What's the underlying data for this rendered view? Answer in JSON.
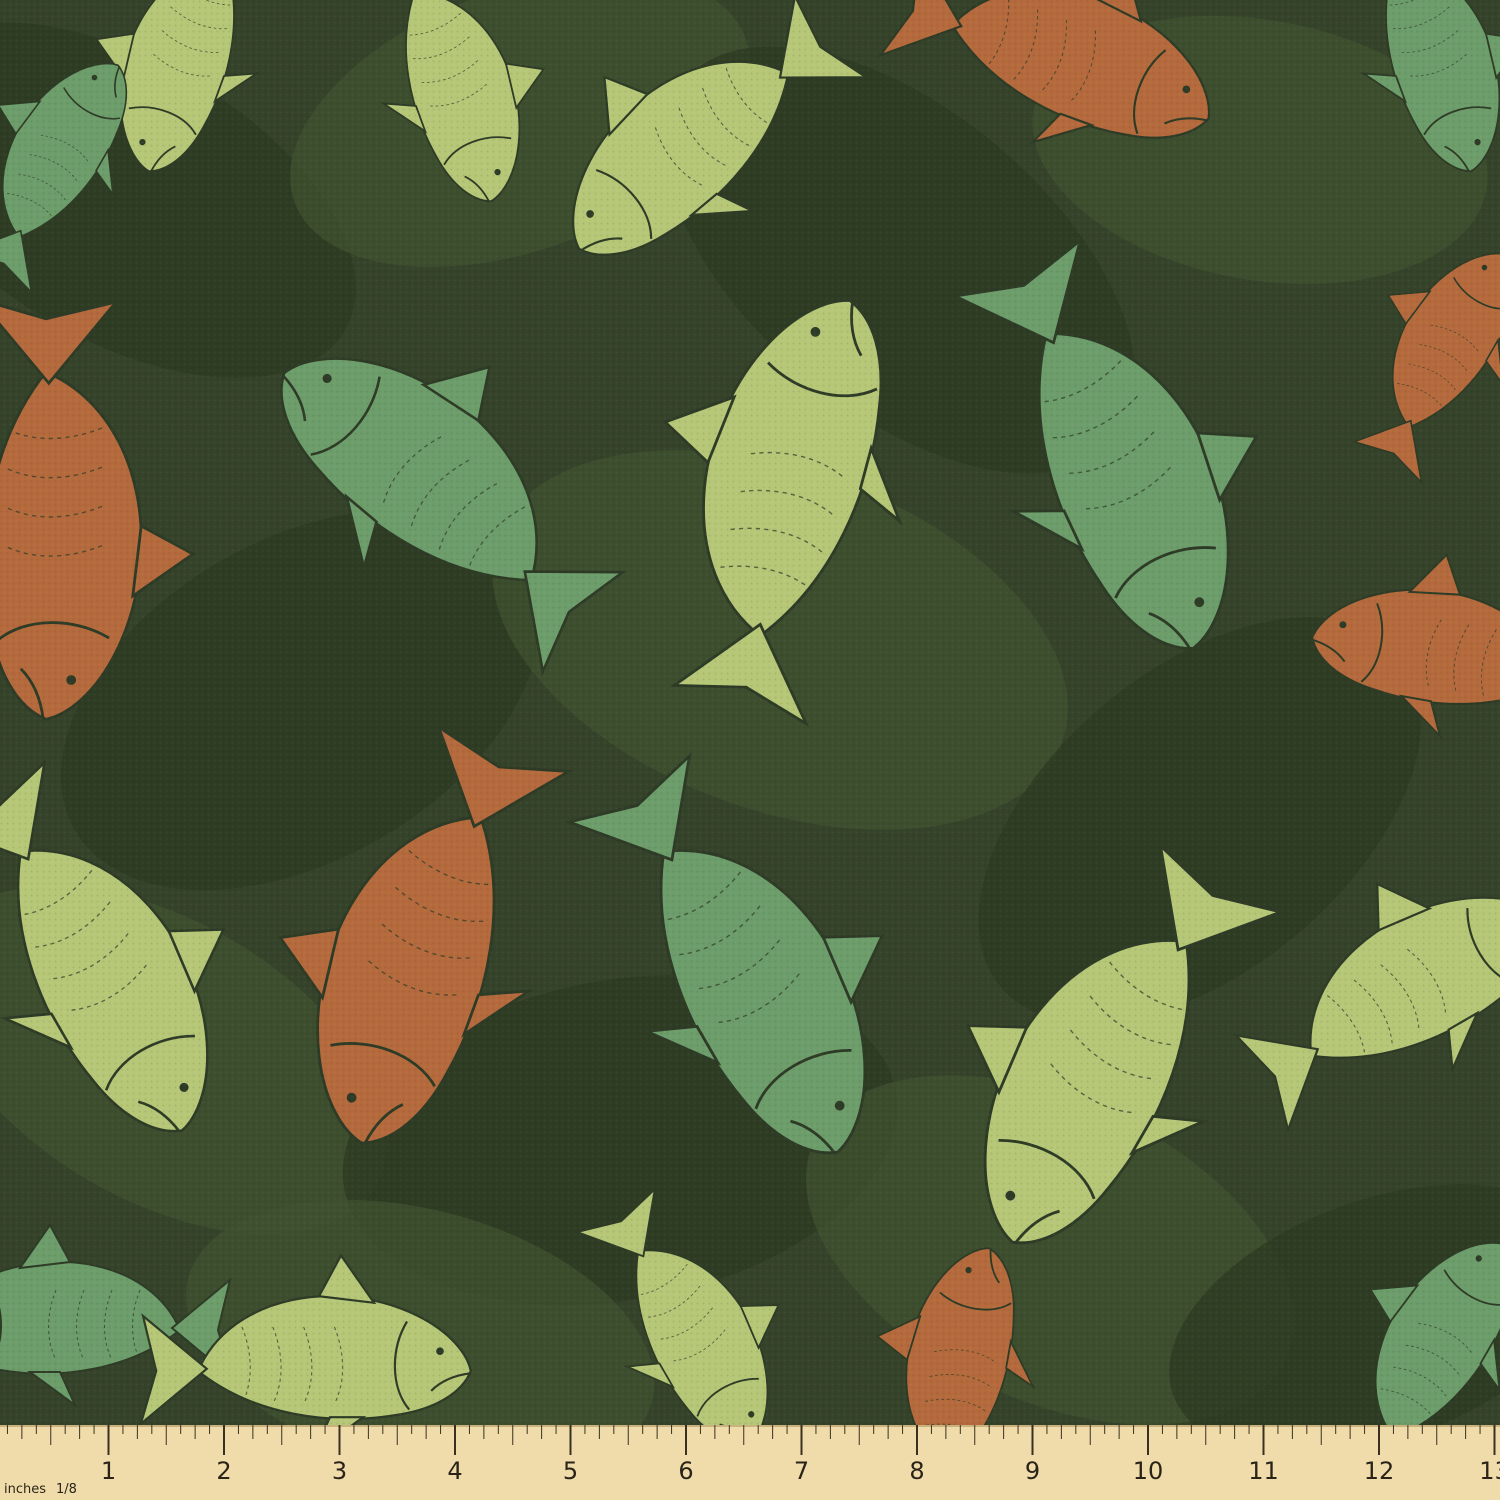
{
  "fabric": {
    "description_colors": {
      "background": "#35432a",
      "shadow_dark": "#2c3a22",
      "shadow_mid": "#3f5230",
      "fish_lime": "#b6c777",
      "fish_green": "#6c9d6a",
      "fish_orange": "#b46a3c",
      "outline": "#2e3b26"
    }
  },
  "ruler": {
    "background": "#f0dcaa",
    "unit_label": "inches",
    "fraction_label": "1/8",
    "numbers": [
      "1",
      "2",
      "3",
      "4",
      "5",
      "6",
      "7",
      "8",
      "9",
      "10",
      "11",
      "12",
      "13"
    ]
  }
}
